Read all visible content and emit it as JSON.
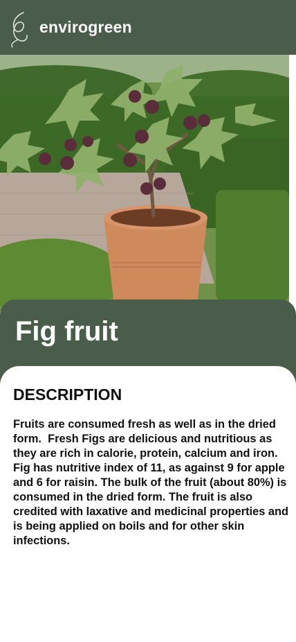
{
  "header": {
    "brand": "envirogreen",
    "logo_icon": "leaf-logo-icon"
  },
  "hero": {
    "image_subject": "potted fig tree"
  },
  "plant": {
    "name": "Fig fruit"
  },
  "description": {
    "heading": "DESCRIPTION",
    "text": "Fruits are consumed fresh as well as in the dried form.  Fresh Figs are delicious and nutritious as they are rich in calorie, protein, calcium and iron. Fig has nutritive index of 11, as against 9 for apple and 6 for raisin. The bulk of the fruit (about 80%) is consumed in the dried form. The fruit is also credited with laxative and medicinal properties and is being applied on boils and for other skin infections."
  },
  "colors": {
    "header_bg": "#4a5d4a",
    "text": "#111111"
  }
}
